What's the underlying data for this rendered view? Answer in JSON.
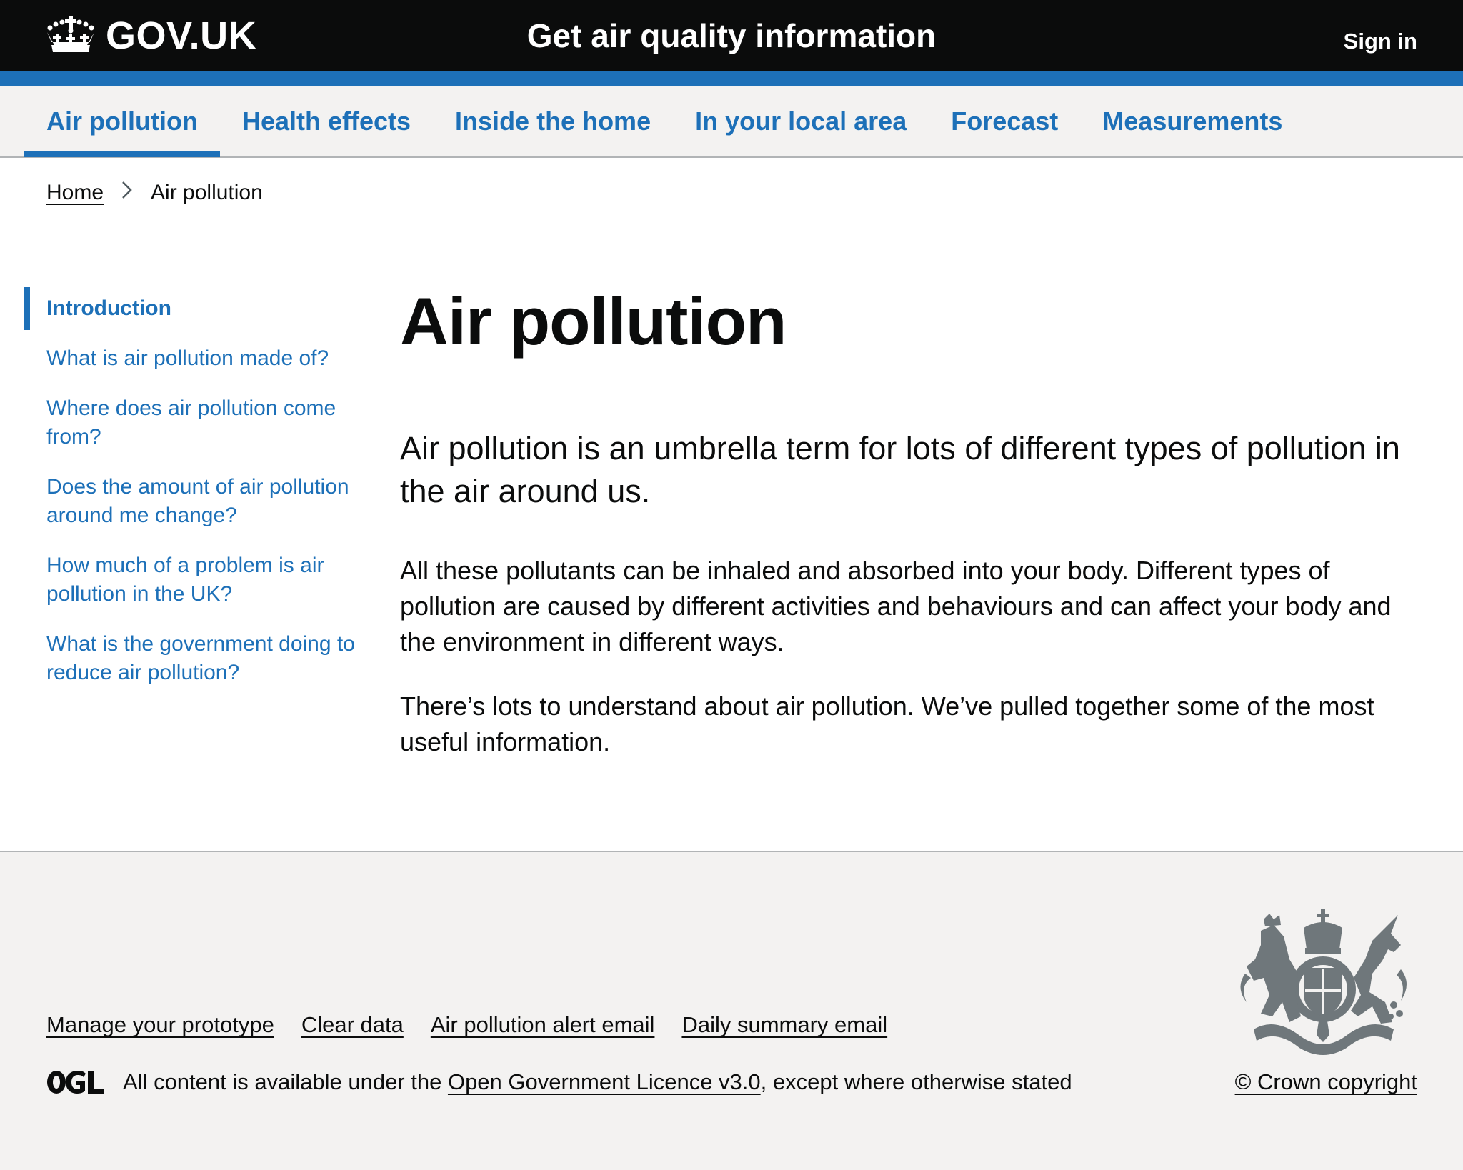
{
  "header": {
    "logo_text": "GOV.UK",
    "logo_icon": "crown-icon",
    "service_name": "Get air quality information",
    "sign_in": "Sign in"
  },
  "colors": {
    "header_bg": "#0b0c0c",
    "brand_blue": "#1d70b8",
    "nav_bg": "#f3f2f1",
    "text": "#0b0c0c",
    "border": "#b1b4b6",
    "crest_grey": "#6f777b"
  },
  "nav": {
    "items": [
      {
        "label": "Air pollution",
        "active": true
      },
      {
        "label": "Health effects",
        "active": false
      },
      {
        "label": "Inside the home",
        "active": false
      },
      {
        "label": "In your local area",
        "active": false
      },
      {
        "label": "Forecast",
        "active": false
      },
      {
        "label": "Measurements",
        "active": false
      }
    ]
  },
  "breadcrumb": {
    "home": "Home",
    "separator_icon": "chevron-right-icon",
    "current": "Air pollution"
  },
  "sidebar": {
    "items": [
      {
        "label": "Introduction",
        "active": true
      },
      {
        "label": "What is air pollution made of?",
        "active": false
      },
      {
        "label": "Where does air pollution come from?",
        "active": false
      },
      {
        "label": "Does the amount of air pollution around me change?",
        "active": false
      },
      {
        "label": "How much of a problem is air pollution in the UK?",
        "active": false
      },
      {
        "label": "What is the government doing to reduce air pollution?",
        "active": false
      }
    ]
  },
  "main": {
    "title": "Air pollution",
    "lead": "Air pollution is an umbrella term for lots of different types of pollution in the air around us.",
    "paragraphs": [
      "All these pollutants can be inhaled and absorbed into your body. Different types of pollution are caused by different activities and behaviours and can affect your body and the environment in different ways.",
      "There’s lots to understand about air pollution. We’ve pulled together some of the most useful information."
    ]
  },
  "footer": {
    "links": [
      "Manage your prototype",
      "Clear data",
      "Air pollution alert email",
      "Daily summary email"
    ],
    "ogl_logo": "OGL",
    "license_prefix": "All content is available under the ",
    "license_link": "Open Government Licence v3.0",
    "license_suffix": ", except where otherwise stated",
    "crest_icon": "royal-coat-of-arms-icon",
    "copyright": "© Crown copyright"
  }
}
